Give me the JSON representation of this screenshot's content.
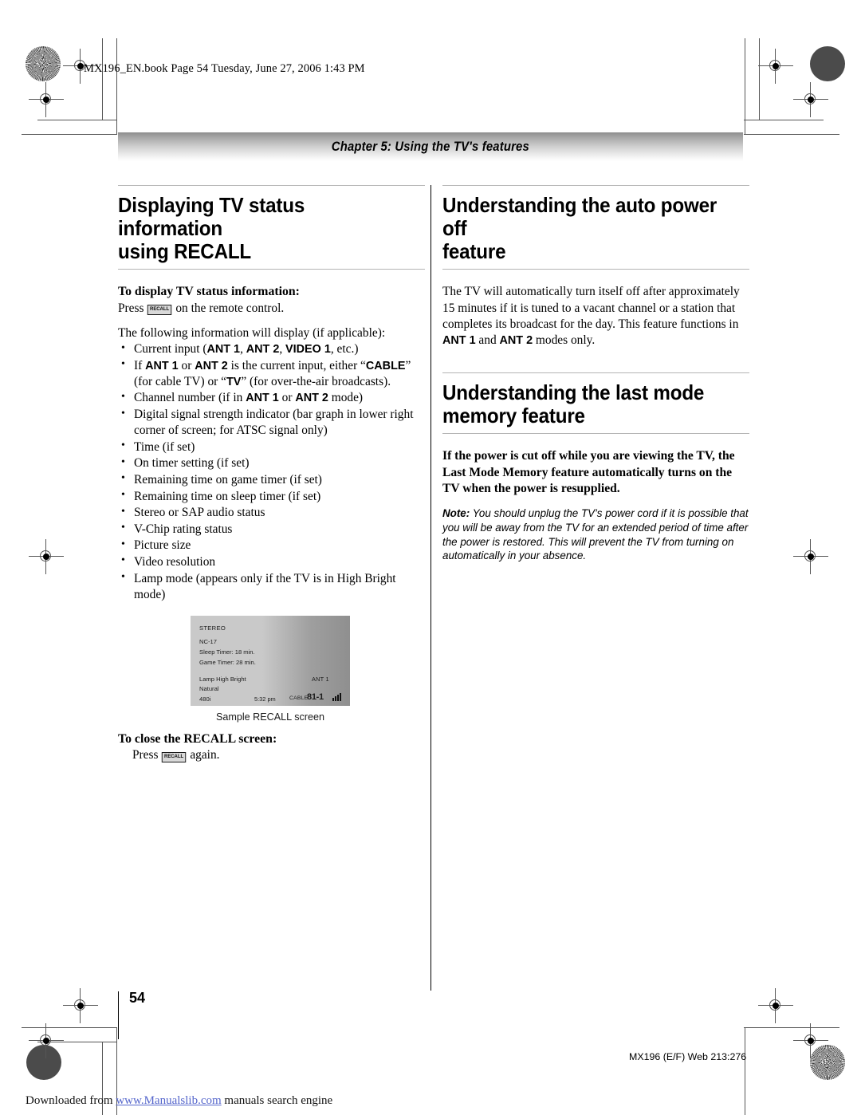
{
  "file_stamp": "MX196_EN.book  Page 54  Tuesday, June 27, 2006  1:43 PM",
  "chapter_banner": "Chapter 5: Using the TV's features",
  "left_column": {
    "heading_line1": "Displaying TV status information",
    "heading_line2": "using RECALL",
    "subheading_display": "To display TV status information:",
    "press_prefix": "Press",
    "recall_key": "RECALL",
    "press_suffix": "on the remote control.",
    "intro": "The following information will display (if applicable):",
    "bullets": [
      {
        "parts": [
          {
            "text": "Current input (",
            "style": "normal"
          },
          {
            "text": "ANT 1",
            "style": "bold-sans"
          },
          {
            "text": ", ",
            "style": "normal"
          },
          {
            "text": "ANT 2",
            "style": "bold-sans"
          },
          {
            "text": ", ",
            "style": "normal"
          },
          {
            "text": "VIDEO 1",
            "style": "bold-sans"
          },
          {
            "text": ", etc.)",
            "style": "normal"
          }
        ]
      },
      {
        "parts": [
          {
            "text": "If ",
            "style": "normal"
          },
          {
            "text": "ANT 1",
            "style": "bold-sans"
          },
          {
            "text": " or ",
            "style": "normal"
          },
          {
            "text": "ANT 2",
            "style": "bold-sans"
          },
          {
            "text": " is the current input, either “",
            "style": "normal"
          },
          {
            "text": "CABLE",
            "style": "bold-sans"
          },
          {
            "text": "” (for cable TV) or “",
            "style": "normal"
          },
          {
            "text": "TV",
            "style": "bold-sans"
          },
          {
            "text": "” (for over-the-air broadcasts).",
            "style": "normal"
          }
        ]
      },
      {
        "parts": [
          {
            "text": "Channel number (if in ",
            "style": "normal"
          },
          {
            "text": "ANT 1",
            "style": "bold-sans"
          },
          {
            "text": " or ",
            "style": "normal"
          },
          {
            "text": "ANT 2",
            "style": "bold-sans"
          },
          {
            "text": " mode)",
            "style": "normal"
          }
        ]
      },
      {
        "parts": [
          {
            "text": "Digital signal strength indicator (bar graph in lower right corner of screen; for ATSC signal only)",
            "style": "normal"
          }
        ]
      },
      {
        "parts": [
          {
            "text": "Time (if set)",
            "style": "normal"
          }
        ]
      },
      {
        "parts": [
          {
            "text": "On timer setting (if set)",
            "style": "normal"
          }
        ]
      },
      {
        "parts": [
          {
            "text": "Remaining time on game timer (if set)",
            "style": "normal"
          }
        ]
      },
      {
        "parts": [
          {
            "text": "Remaining time on sleep timer (if set)",
            "style": "normal"
          }
        ]
      },
      {
        "parts": [
          {
            "text": "Stereo or SAP audio status",
            "style": "normal"
          }
        ]
      },
      {
        "parts": [
          {
            "text": "V-Chip rating status",
            "style": "normal"
          }
        ]
      },
      {
        "parts": [
          {
            "text": "Picture size",
            "style": "normal"
          }
        ]
      },
      {
        "parts": [
          {
            "text": "Video resolution",
            "style": "normal"
          }
        ]
      },
      {
        "parts": [
          {
            "text": "Lamp mode (appears only if the TV is in High Bright mode)",
            "style": "normal"
          }
        ]
      }
    ],
    "recall_screen": {
      "stereo": "STEREO",
      "rating": "NC-17",
      "sleep_timer": "Sleep Timer: 18 min.",
      "game_timer": "Game Timer: 28 min.",
      "lamp": "Lamp High Bright",
      "picture_mode": "Natural",
      "resolution": "480i",
      "antenna": "ANT 1",
      "time": "5:32 pm",
      "source": "CABLE",
      "channel": "81-1",
      "signal_bars": 4
    },
    "figure_caption": "Sample RECALL screen",
    "subheading_close": "To close the RECALL screen:",
    "close_prefix": "Press",
    "close_suffix": "again."
  },
  "right_column": {
    "section1": {
      "heading_line1": "Understanding the auto power off",
      "heading_line2": "feature",
      "body_parts": [
        {
          "text": "The TV will automatically turn itself off after approximately 15 minutes if it is tuned to a vacant channel or a station that completes its broadcast for the day. This feature functions in ",
          "style": "normal"
        },
        {
          "text": "ANT 1",
          "style": "bold-sans"
        },
        {
          "text": " and ",
          "style": "normal"
        },
        {
          "text": "ANT 2",
          "style": "bold-sans"
        },
        {
          "text": " modes only.",
          "style": "normal"
        }
      ]
    },
    "section2": {
      "heading_line1": "Understanding the last mode",
      "heading_line2": "memory feature",
      "lead_bold": "If the power is cut off while you are viewing the TV, the Last Mode Memory feature automatically turns on the TV when the power is resupplied.",
      "note_label": "Note:",
      "note_text": " You should unplug the TV’s power cord if it is possible that you will be away from the TV for an extended period of time after the power is restored. This will prevent the TV from turning on automatically in your absence."
    }
  },
  "footer": {
    "page_number": "54",
    "doc_code": "MX196 (E/F) Web 213:276",
    "downloaded_prefix": "Downloaded from ",
    "downloaded_link": "www.Manualslib.com",
    "downloaded_suffix": " manuals search engine"
  }
}
